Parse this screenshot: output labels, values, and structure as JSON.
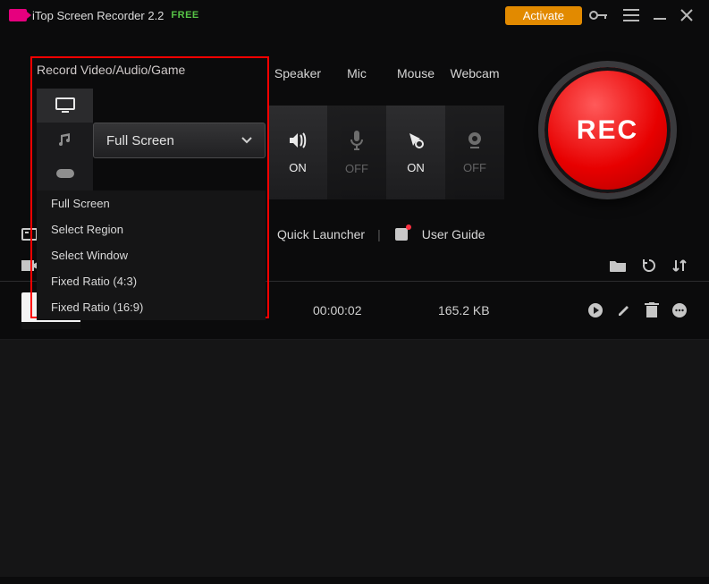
{
  "titlebar": {
    "app_title": "iTop Screen Recorder 2.2",
    "free_badge": "FREE",
    "activate_label": "Activate"
  },
  "panel": {
    "title": "Record Video/Audio/Game",
    "selected_mode": "Full Screen",
    "options": [
      "Full Screen",
      "Select Region",
      "Select Window",
      "Fixed Ratio  (4:3)",
      "Fixed Ratio  (16:9)"
    ]
  },
  "toggles": [
    {
      "label": "Speaker",
      "state": "ON",
      "icon": "volume"
    },
    {
      "label": "Mic",
      "state": "OFF",
      "icon": "mic"
    },
    {
      "label": "Mouse",
      "state": "ON",
      "icon": "cursor"
    },
    {
      "label": "Webcam",
      "state": "OFF",
      "icon": "camera"
    }
  ],
  "record_label": "REC",
  "midbar": {
    "quick_launcher": "Quick Launcher",
    "user_guide": "User Guide"
  },
  "recording": {
    "name": "",
    "duration": "00:00:02",
    "size": "165.2 KB"
  },
  "colors": {
    "accent_orange": "#e28a00",
    "accent_red": "#e70000",
    "highlight": "#ff0000"
  }
}
